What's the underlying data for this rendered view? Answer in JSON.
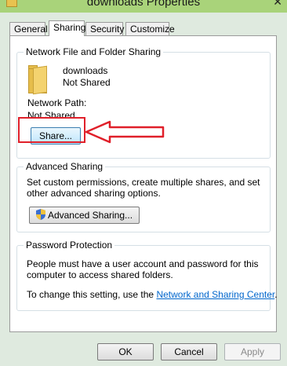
{
  "window": {
    "title": "downloads Properties",
    "close_glyph": "✕"
  },
  "tabs": [
    {
      "label": "General"
    },
    {
      "label": "Sharing"
    },
    {
      "label": "Security"
    },
    {
      "label": "Customize"
    }
  ],
  "network_sharing": {
    "heading": "Network File and Folder Sharing",
    "folder_name": "downloads",
    "folder_status": "Not Shared",
    "network_path_label": "Network Path:",
    "network_path_value": "Not Shared",
    "share_button": "Share..."
  },
  "advanced_sharing": {
    "heading": "Advanced Sharing",
    "description": "Set custom permissions, create multiple shares, and set other advanced sharing options.",
    "button": "Advanced Sharing..."
  },
  "password_protection": {
    "heading": "Password Protection",
    "description": "People must have a user account and password for this computer to access shared folders.",
    "change_text": "To change this setting, use the ",
    "link": "Network and Sharing Center",
    "change_suffix": "."
  },
  "footer": {
    "ok": "OK",
    "cancel": "Cancel",
    "apply": "Apply"
  },
  "annotation": {
    "color": "#e0202a"
  }
}
